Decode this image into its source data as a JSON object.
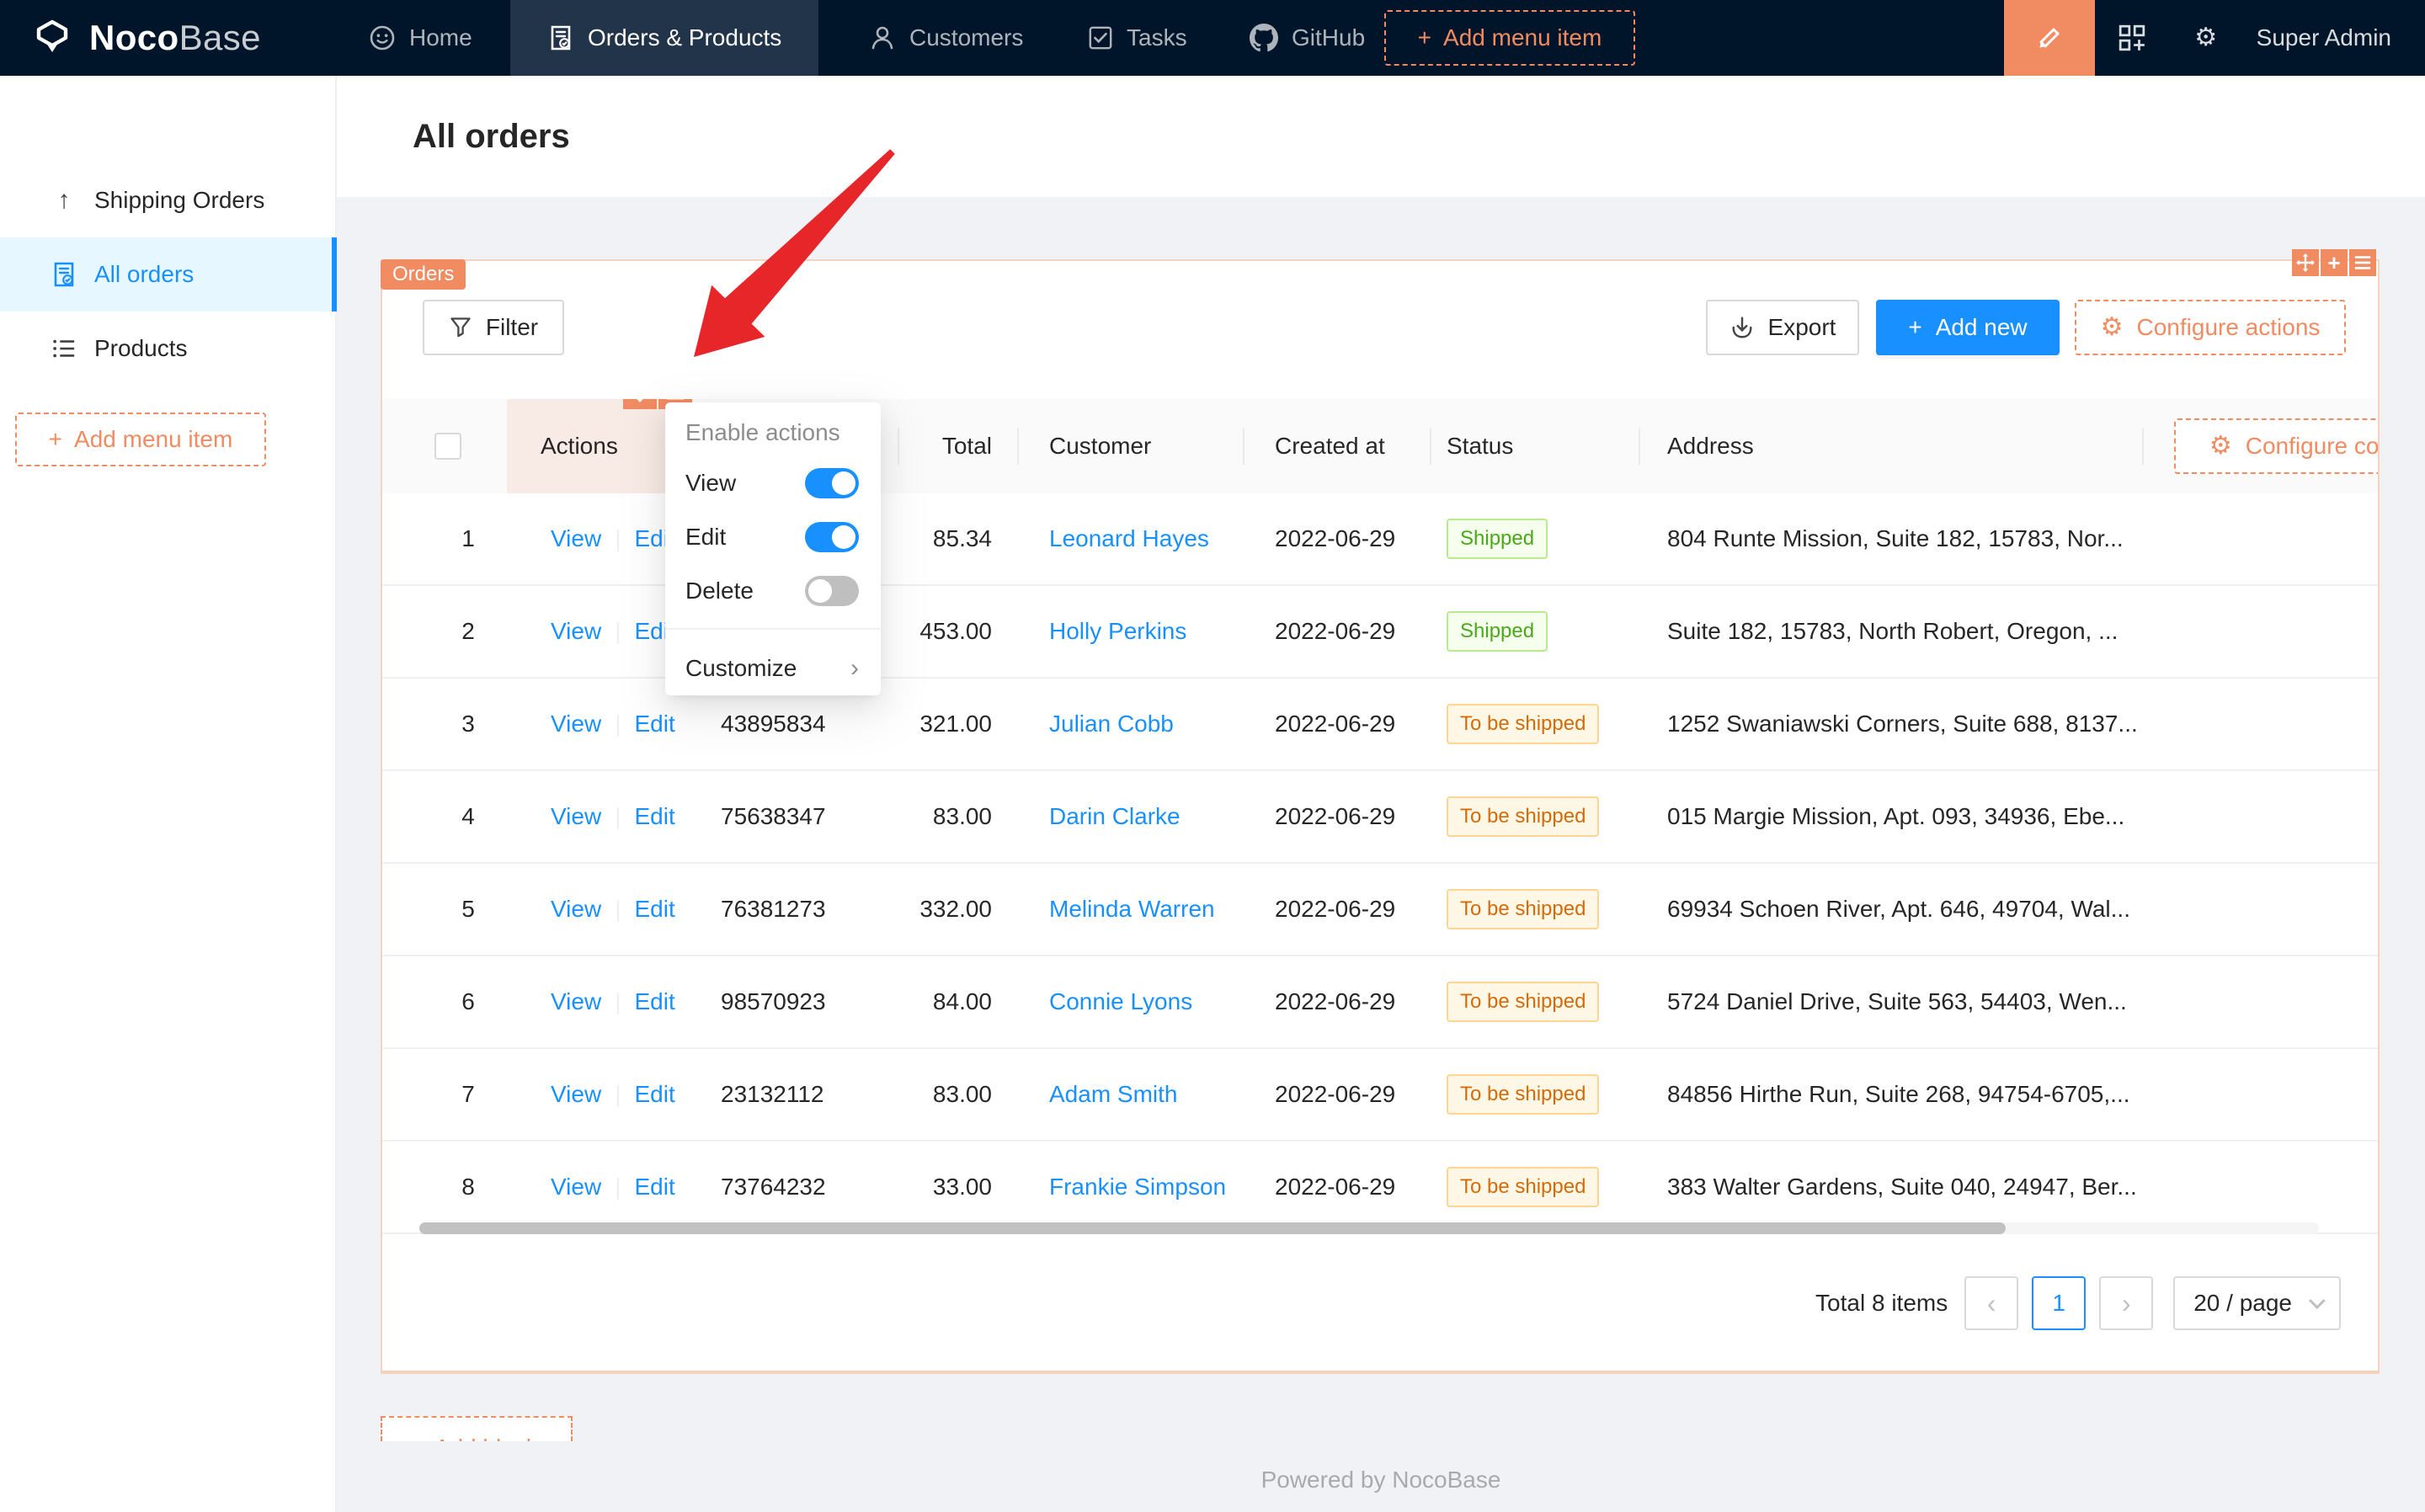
{
  "navbar": {
    "logo": {
      "bold": "Noco",
      "light": "Base"
    },
    "items": [
      {
        "label": "Home"
      },
      {
        "label": "Orders & Products",
        "active": true
      },
      {
        "label": "Customers"
      },
      {
        "label": "Tasks"
      },
      {
        "label": "GitHub"
      }
    ],
    "add_menu_item": "Add menu item",
    "user": "Super Admin"
  },
  "sidebar": {
    "items": [
      {
        "label": "Shipping Orders"
      },
      {
        "label": "All orders",
        "active": true
      },
      {
        "label": "Products"
      }
    ],
    "add_menu_item": "Add menu item"
  },
  "page": {
    "title": "All orders",
    "footer": "Powered by NocoBase",
    "add_block_partial": "+ Add block"
  },
  "block": {
    "tag": "Orders",
    "toolbar": {
      "filter": "Filter",
      "export": "Export",
      "add_new": "Add new",
      "configure_actions": "Configure actions"
    },
    "table": {
      "headers": {
        "actions": "Actions",
        "total": "Total",
        "customer": "Customer",
        "created_at": "Created at",
        "status": "Status",
        "address": "Address",
        "configure_columns": "Configure columns"
      },
      "row_actions": {
        "view": "View",
        "edit": "Edit"
      },
      "rows": [
        {
          "n": "1",
          "order": "",
          "total": "85.34",
          "customer": "Leonard Hayes",
          "date": "2022-06-29",
          "status": "Shipped",
          "kind": "green",
          "address": "804 Runte Mission, Suite 182, 15783, Nor..."
        },
        {
          "n": "2",
          "order": "",
          "total": "453.00",
          "customer": "Holly Perkins",
          "date": "2022-06-29",
          "status": "Shipped",
          "kind": "green",
          "address": "Suite 182, 15783, North Robert, Oregon, ..."
        },
        {
          "n": "3",
          "order": "43895834",
          "total": "321.00",
          "customer": "Julian Cobb",
          "date": "2022-06-29",
          "status": "To be shipped",
          "kind": "orange",
          "address": "1252 Swaniawski Corners, Suite 688, 8137..."
        },
        {
          "n": "4",
          "order": "75638347",
          "total": "83.00",
          "customer": "Darin Clarke",
          "date": "2022-06-29",
          "status": "To be shipped",
          "kind": "orange",
          "address": "015 Margie Mission, Apt. 093, 34936, Ebe..."
        },
        {
          "n": "5",
          "order": "76381273",
          "total": "332.00",
          "customer": "Melinda Warren",
          "date": "2022-06-29",
          "status": "To be shipped",
          "kind": "orange",
          "address": "69934 Schoen River, Apt. 646, 49704, Wal..."
        },
        {
          "n": "6",
          "order": "98570923",
          "total": "84.00",
          "customer": "Connie Lyons",
          "date": "2022-06-29",
          "status": "To be shipped",
          "kind": "orange",
          "address": "5724 Daniel Drive, Suite 563, 54403, Wen..."
        },
        {
          "n": "7",
          "order": "23132112",
          "total": "83.00",
          "customer": "Adam Smith",
          "date": "2022-06-29",
          "status": "To be shipped",
          "kind": "orange",
          "address": "84856 Hirthe Run, Suite 268, 94754-6705,..."
        },
        {
          "n": "8",
          "order": "73764232",
          "total": "33.00",
          "customer": "Frankie Simpson",
          "date": "2022-06-29",
          "status": "To be shipped",
          "kind": "orange",
          "address": "383 Walter Gardens, Suite 040, 24947, Ber..."
        }
      ]
    },
    "pagination": {
      "total": "Total 8 items",
      "prev": "‹",
      "page": "1",
      "next": "›",
      "page_size": "20 / page"
    }
  },
  "dropdown": {
    "header": "Enable actions",
    "switches": [
      {
        "label": "View",
        "on": true
      },
      {
        "label": "Edit",
        "on": true
      },
      {
        "label": "Delete",
        "on": false
      }
    ],
    "customize": "Customize"
  },
  "colors": {
    "navbar_bg": "#001529",
    "accent_orange": "#f18b62",
    "primary_blue": "#1890ff",
    "status_green": "#49aa19",
    "status_orange": "#d46b08",
    "arrow_red": "#e7262a"
  }
}
